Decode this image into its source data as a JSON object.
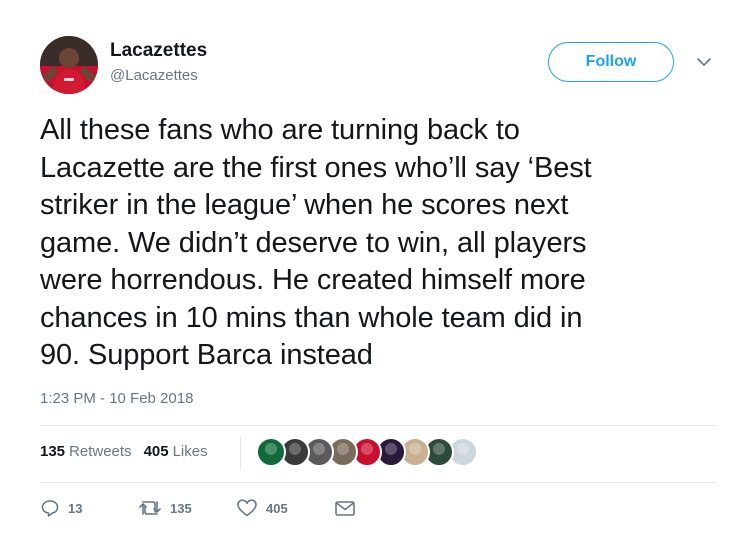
{
  "user": {
    "display_name": "Lacazettes",
    "screen_name": "@Lacazettes"
  },
  "follow_label": "Follow",
  "tweet": {
    "text": "All these fans who are turning back to\nLacazette are the first ones who’ll say ‘Best\nstriker in the league’ when he scores next\ngame. We didn’t deserve to win, all players\nwere horrendous. He created himself more\nchances in 10 mins than whole team did in\n90. Support Barca instead",
    "timestamp": "1:23 PM - 10 Feb 2018"
  },
  "stats": {
    "retweets_count": "135",
    "retweets_label": "Retweets",
    "likes_count": "405",
    "likes_label": "Likes"
  },
  "likers": [
    {
      "name": "liker-avatar",
      "color": "#0f6b3a"
    },
    {
      "name": "liker-avatar",
      "color": "#3a3a3a"
    },
    {
      "name": "liker-avatar",
      "color": "#5a5a5a"
    },
    {
      "name": "liker-avatar",
      "color": "#7a6a5a"
    },
    {
      "name": "liker-avatar",
      "color": "#c8102e"
    },
    {
      "name": "liker-avatar",
      "color": "#2a1a3a"
    },
    {
      "name": "liker-avatar",
      "color": "#c8b090"
    },
    {
      "name": "liker-avatar",
      "color": "#2e4a3a"
    },
    {
      "name": "liker-avatar",
      "color": "#ccd6dd"
    }
  ],
  "actions": {
    "reply_count": "13",
    "retweet_count": "135",
    "like_count": "405"
  },
  "colors": {
    "accent": "#1da1f2",
    "text": "#14171a",
    "secondary": "#657786",
    "border": "#e1e8ed"
  },
  "icons": [
    "reply-icon",
    "retweet-icon",
    "heart-icon",
    "message-icon",
    "chevron-down-icon"
  ]
}
